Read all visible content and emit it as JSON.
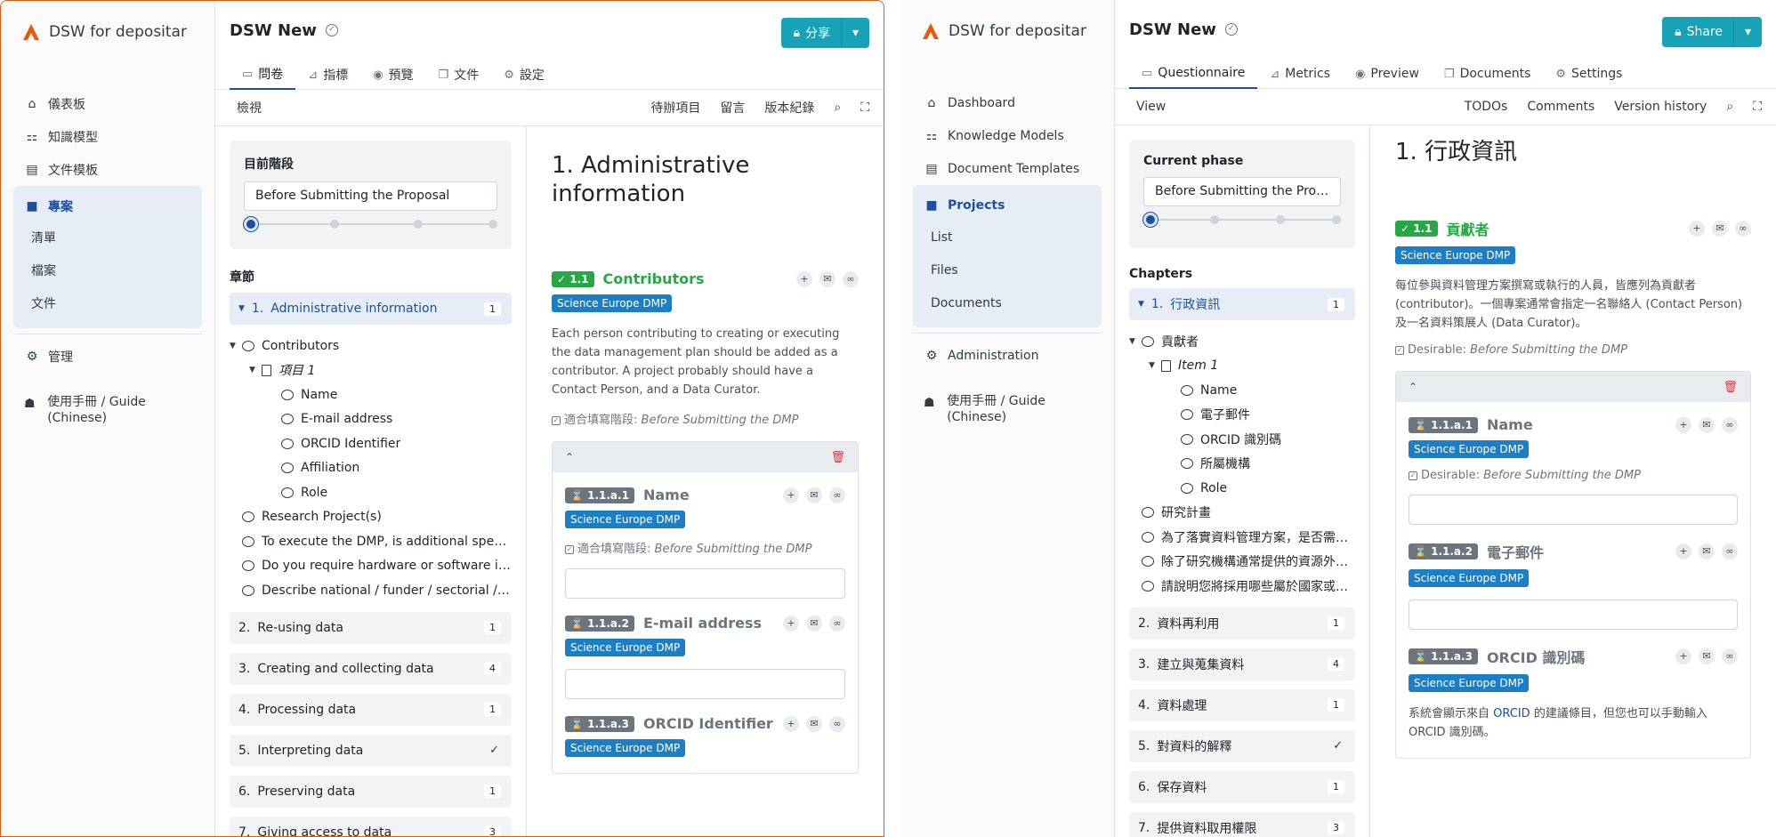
{
  "brand": {
    "name": "DSW for depositar"
  },
  "colors": {
    "accent": "#1c4fa0",
    "share": "#17a2b8",
    "completed": "#28a745",
    "pending": "#6c757d",
    "tag": "#1c7fc6",
    "frame": "#e8590c"
  },
  "left": {
    "sidebar": {
      "dashboard": "儀表板",
      "knowledge_models": "知識模型",
      "document_templates": "文件模板",
      "projects": "專案",
      "sub": [
        "清單",
        "檔案",
        "文件"
      ],
      "administration": "管理",
      "guide": "使用手冊 / Guide (Chinese)"
    },
    "project_title": "DSW New",
    "share_label": "分享",
    "tabs": [
      "問卷",
      "指標",
      "預覽",
      "文件",
      "設定"
    ],
    "toolbar": {
      "view": "檢視",
      "todos": "待辦項目",
      "comments": "留言",
      "history": "版本紀錄"
    },
    "phase": {
      "label": "目前階段",
      "value": "Before Submitting the Proposal"
    },
    "chapters_label": "章節",
    "chapters": [
      {
        "num": "1.",
        "label": "Administrative information",
        "badge": "1"
      },
      {
        "num": "2.",
        "label": "Re-using data",
        "badge": "1"
      },
      {
        "num": "3.",
        "label": "Creating and collecting data",
        "badge": "4"
      },
      {
        "num": "4.",
        "label": "Processing data",
        "badge": "1"
      },
      {
        "num": "5.",
        "label": "Interpreting data",
        "badge": "✓"
      },
      {
        "num": "6.",
        "label": "Preserving data",
        "badge": "1"
      },
      {
        "num": "7.",
        "label": "Giving access to data",
        "badge": "3"
      }
    ],
    "tree": {
      "contributors": "Contributors",
      "item": "項目 1",
      "fields": [
        "Name",
        "E-mail address",
        "ORCID Identifier",
        "Affiliation",
        "Role"
      ],
      "others": [
        "Research Project(s)",
        "To execute the DMP, is additional specialist expertise (or training for existing expertise) required?",
        "Do you require hardware or software in addition to existing institutional provision?",
        "Describe national / funder / sectorial / departmental procedures for data management"
      ]
    },
    "content": {
      "title": "1. Administrative information",
      "q_num": "✓ 1.1",
      "q_name": "Contributors",
      "tag": "Science Europe DMP",
      "desc": "Each person contributing to creating or executing the data management plan should be added as a contributor. A project probably should have a Contact Person, and a Data Curator.",
      "desir_prefix": "適合填寫階段:",
      "desir_value": "Before Submitting the DMP",
      "subs": [
        {
          "num": "⌛ 1.1.a.1",
          "name": "Name",
          "tag": "Science Europe DMP"
        },
        {
          "num": "⌛ 1.1.a.2",
          "name": "E-mail address",
          "tag": "Science Europe DMP"
        },
        {
          "num": "⌛ 1.1.a.3",
          "name": "ORCID Identifier",
          "tag": "Science Europe DMP"
        }
      ]
    }
  },
  "right": {
    "sidebar": {
      "dashboard": "Dashboard",
      "knowledge_models": "Knowledge Models",
      "document_templates": "Document Templates",
      "projects": "Projects",
      "sub": [
        "List",
        "Files",
        "Documents"
      ],
      "administration": "Administration",
      "guide": "使用手冊 / Guide (Chinese)"
    },
    "project_title": "DSW New",
    "share_label": "Share",
    "tabs": [
      "Questionnaire",
      "Metrics",
      "Preview",
      "Documents",
      "Settings"
    ],
    "toolbar": {
      "view": "View",
      "todos": "TODOs",
      "comments": "Comments",
      "history": "Version history"
    },
    "phase": {
      "label": "Current phase",
      "value": "Before Submitting the Proposal"
    },
    "chapters_label": "Chapters",
    "chapters": [
      {
        "num": "1.",
        "label": "行政資訊",
        "badge": "1"
      },
      {
        "num": "2.",
        "label": "資料再利用",
        "badge": "1"
      },
      {
        "num": "3.",
        "label": "建立與蒐集資料",
        "badge": "4"
      },
      {
        "num": "4.",
        "label": "資料處理",
        "badge": "1"
      },
      {
        "num": "5.",
        "label": "對資料的解釋",
        "badge": "✓"
      },
      {
        "num": "6.",
        "label": "保存資料",
        "badge": "1"
      },
      {
        "num": "7.",
        "label": "提供資料取用權限",
        "badge": "3"
      }
    ],
    "tree": {
      "contributors": "貢獻者",
      "item": "Item 1",
      "fields": [
        "Name",
        "電子郵件",
        "ORCID 識別碼",
        "所屬機構",
        "Role"
      ],
      "others": [
        "研究計畫",
        "為了落實資料管理方案，是否需要額外的專業知識或訓練？",
        "除了研究機構通常提供的資源外，是否需要額外的硬體或軟體？",
        "請說明您將採用哪些屬於國家或資助機構的資料管理程序"
      ]
    },
    "content": {
      "title": "1. 行政資訊",
      "q_num": "✓ 1.1",
      "q_name": "貢獻者",
      "tag": "Science Europe DMP",
      "desc": "每位參與資料管理方案撰寫或執行的人員，皆應列為貢獻者 (contributor)。一個專案通常會指定一名聯絡人 (Contact Person) 及一名資料策展人 (Data Curator)。",
      "desir_prefix": "Desirable:",
      "desir_value": "Before Submitting the DMP",
      "subs": [
        {
          "num": "⌛ 1.1.a.1",
          "name": "Name",
          "tag": "Science Europe DMP",
          "desir": true
        },
        {
          "num": "⌛ 1.1.a.2",
          "name": "電子郵件",
          "tag": "Science Europe DMP"
        },
        {
          "num": "⌛ 1.1.a.3",
          "name": "ORCID 識別碼",
          "tag": "Science Europe DMP"
        }
      ],
      "orcid_hint_a": "系統會顯示來自",
      "orcid_link": "ORCID",
      "orcid_hint_b": "的建議條目，但您也可以手動輸入 ORCID 識別碼。"
    }
  }
}
